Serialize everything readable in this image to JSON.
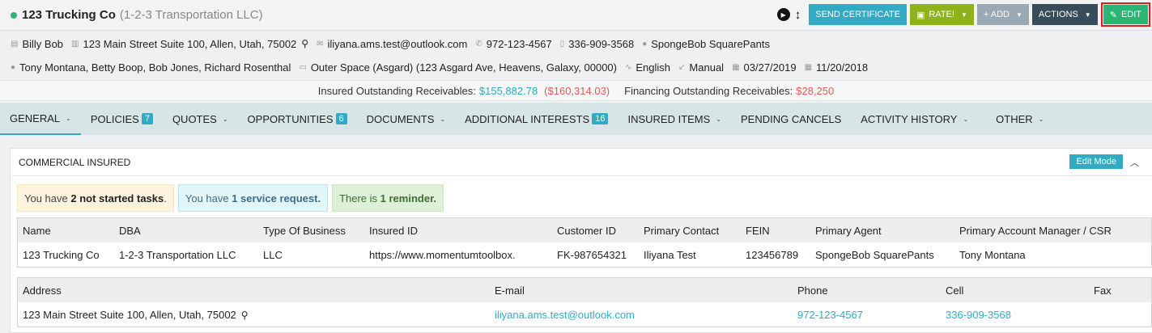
{
  "header": {
    "title": "123 Trucking Co",
    "subtitle": "(1-2-3 Transportation LLC)",
    "buttons": {
      "send_certificate": "SEND CERTIFICATE",
      "rate": "RATE!",
      "add": "+ ADD",
      "actions": "ACTIONS",
      "edit": "EDIT"
    }
  },
  "info_row1": {
    "contact_name": "Billy Bob",
    "address": "123 Main Street Suite 100, Allen, Utah, 75002",
    "email": "iliyana.ams.test@outlook.com",
    "phone": "972-123-4567",
    "mobile": "336-909-3568",
    "agent": "SpongeBob SquarePants"
  },
  "info_row2": {
    "team": "Tony Montana, Betty Boop, Bob Jones, Richard Rosenthal",
    "location": "Outer Space (Asgard) (123 Asgard Ave, Heavens, Galaxy, 00000)",
    "language": "English",
    "source": "Manual",
    "date1": "03/27/2019",
    "date2": "11/20/2018"
  },
  "receivables": {
    "insured_label": "Insured Outstanding Receivables:",
    "insured_value": "$155,882.78",
    "insured_negative": "($160,314.03)",
    "financing_label": "Financing Outstanding Receivables:",
    "financing_value": "$28,250"
  },
  "tabs": [
    {
      "label": "GENERAL",
      "badge": ""
    },
    {
      "label": "POLICIES",
      "badge": "7"
    },
    {
      "label": "QUOTES",
      "badge": ""
    },
    {
      "label": "OPPORTUNITIES",
      "badge": "6"
    },
    {
      "label": "DOCUMENTS",
      "badge": ""
    },
    {
      "label": "ADDITIONAL INTERESTS",
      "badge": "16"
    },
    {
      "label": "INSURED ITEMS",
      "badge": ""
    },
    {
      "label": "PENDING CANCELS",
      "badge": ""
    },
    {
      "label": "ACTIVITY HISTORY",
      "badge": ""
    },
    {
      "label": "OTHER",
      "badge": ""
    }
  ],
  "panel": {
    "title": "COMMERCIAL INSURED",
    "edit_mode": "Edit Mode"
  },
  "alerts": {
    "tasks_prefix": "You have ",
    "tasks_bold": "2 not started tasks",
    "tasks_suffix": ".",
    "service_prefix": "You have ",
    "service_bold": "1 service request.",
    "reminder_prefix": "There is ",
    "reminder_bold": "1 reminder."
  },
  "table1": {
    "headers": [
      "Name",
      "DBA",
      "Type Of Business",
      "Insured ID",
      "Customer ID",
      "Primary Contact",
      "FEIN",
      "Primary Agent",
      "Primary Account Manager / CSR"
    ],
    "row": [
      "123 Trucking Co",
      "1-2-3 Transportation LLC",
      "LLC",
      "https://www.momentumtoolbox.",
      "FK-987654321",
      "Iliyana Test",
      "123456789",
      "SpongeBob SquarePants",
      "Tony Montana"
    ]
  },
  "table2": {
    "headers": [
      "Address",
      "E-mail",
      "Phone",
      "Cell",
      "Fax"
    ],
    "row": [
      "123 Main Street Suite 100, Allen, Utah, 75002",
      "iliyana.ams.test@outlook.com",
      "972-123-4567",
      "336-909-3568",
      ""
    ]
  }
}
